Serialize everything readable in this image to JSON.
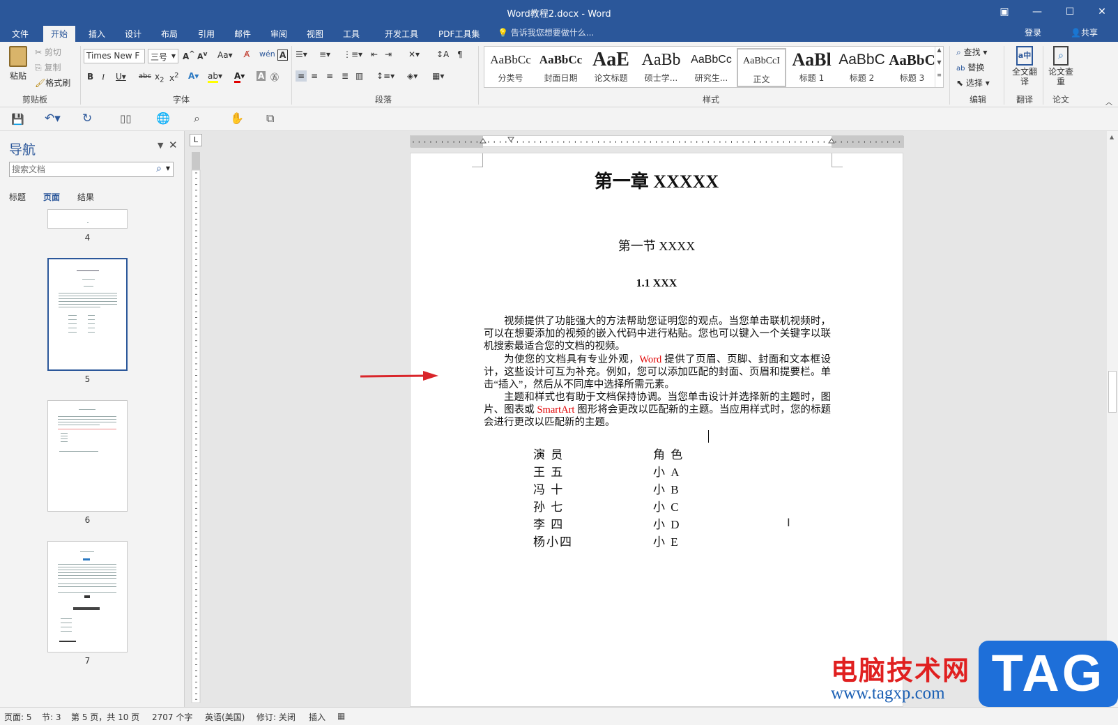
{
  "window": {
    "title": "Word教程2.docx - Word"
  },
  "tabs": [
    "文件",
    "开始",
    "插入",
    "设计",
    "布局",
    "引用",
    "邮件",
    "审阅",
    "视图",
    "工具",
    "开发工具",
    "PDF工具集"
  ],
  "tell_me": "告诉我您想要做什么...",
  "signin": "登录",
  "share": "共享",
  "ribbon": {
    "clipboard": {
      "paste": "粘贴",
      "cut": "剪切",
      "copy": "复制",
      "format_painter": "格式刷",
      "group": "剪贴板"
    },
    "font": {
      "name": "Times New F",
      "size": "三号",
      "group": "字体"
    },
    "paragraph": {
      "group": "段落"
    },
    "styles": {
      "group": "样式",
      "items": [
        {
          "preview": "AaBbCc",
          "label": "分类号"
        },
        {
          "preview": "AaBbCc",
          "label": "封面日期"
        },
        {
          "preview": "AaE",
          "label": "论文标题"
        },
        {
          "preview": "AaBb",
          "label": "硕士学..."
        },
        {
          "preview": "AaBbCc",
          "label": "研究生..."
        },
        {
          "preview": "AaBbCcI",
          "label": "正文"
        },
        {
          "preview": "AaBl",
          "label": "标题 1"
        },
        {
          "preview": "AaBbC",
          "label": "标题 2"
        },
        {
          "preview": "AaBbC",
          "label": "标题 3"
        }
      ]
    },
    "editing": {
      "find": "查找",
      "replace": "替换",
      "select": "选择",
      "group": "编辑"
    },
    "translate": {
      "btn": "全文翻译",
      "group": "翻译"
    },
    "paper": {
      "btn": "论文查重",
      "group": "论文"
    }
  },
  "nav": {
    "title": "导航",
    "search_placeholder": "搜索文档",
    "tabs": [
      "标题",
      "页面",
      "结果"
    ],
    "pages": [
      "4",
      "5",
      "6",
      "7"
    ]
  },
  "document": {
    "chapter": "第一章  XXXXX",
    "section": "第一节  XXXX",
    "subsection": "1.1 XXX",
    "p1": "视频提供了功能强大的方法帮助您证明您的观点。当您单击联机视频时，可以在想要添加的视频的嵌入代码中进行粘贴。您也可以键入一个关键字以联机搜索最适合您的文档的视频。",
    "p2_a": "为使您的文档具有专业外观，",
    "p2_word": "Word",
    "p2_b": " 提供了页眉、页脚、封面和文本框设计，这些设计可互为补充。例如，您可以添加匹配的封面、页眉和提要栏。单击“插入”，然后从不同库中选择所需元素。",
    "p3_a": "主题和样式也有助于文档保持协调。当您单击设计并选择新的主题时，图片、图表或 ",
    "p3_smartart": "SmartArt",
    "p3_b": " 图形将会更改以匹配新的主题。当应用样式时，您的标题会进行更改以匹配新的主题。",
    "table": [
      [
        "演  员",
        "角 色"
      ],
      [
        "王  五",
        "小  A"
      ],
      [
        "冯  十",
        "小  B"
      ],
      [
        "孙  七",
        "小  C"
      ],
      [
        "李  四",
        "小  D"
      ],
      [
        "杨小四",
        "小  E"
      ]
    ]
  },
  "status": {
    "page": "页面: 5",
    "section": "节: 3",
    "pages": "第 5 页，共 10 页",
    "words": "2707 个字",
    "lang": "英语(美国)",
    "track": "修订: 关闭",
    "mode": "插入"
  },
  "watermark": {
    "site_name": "电脑技术网",
    "url": "www.tagxp.com",
    "logo": "TAG"
  },
  "colors": {
    "brand": "#2b579a",
    "red_text": "#e00000",
    "arrow": "#d9252a"
  }
}
